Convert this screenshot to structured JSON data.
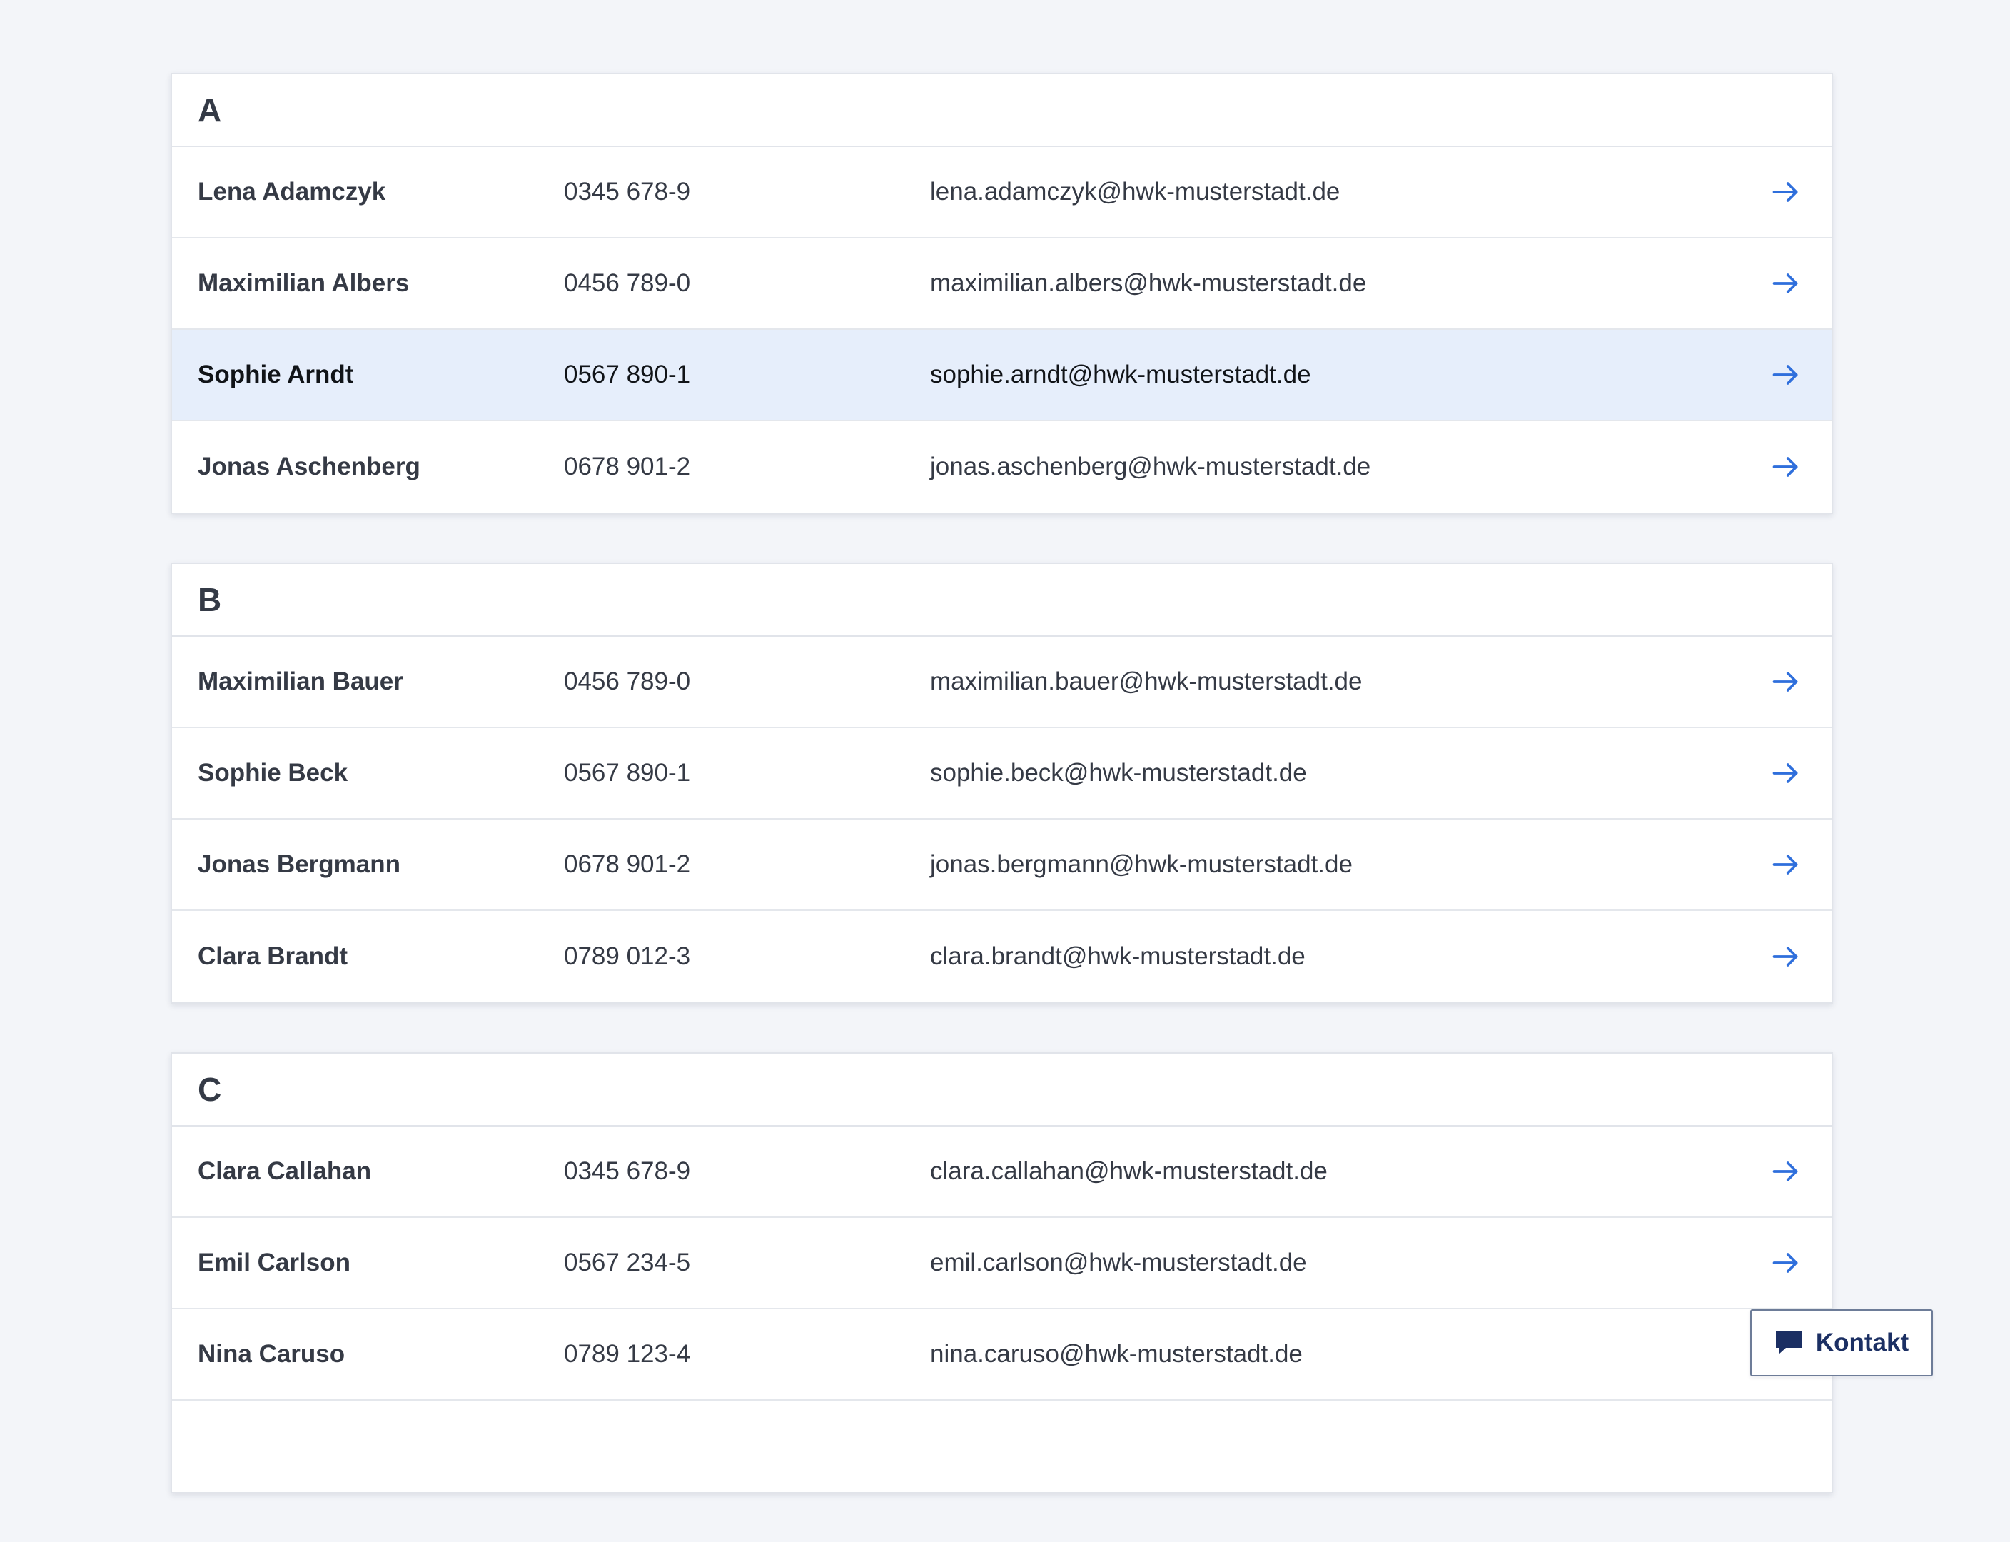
{
  "colors": {
    "page_background": "#f3f5f9",
    "selected_row": "#e6eefb",
    "arrow_accent": "#2f6fdc",
    "kontakt_text": "#1b2f63"
  },
  "groups": [
    {
      "letter": "A",
      "rows": [
        {
          "name": "Lena Adamczyk",
          "phone": "0345 678-9",
          "email": "lena.adamczyk@hwk-musterstadt.de",
          "selected": false
        },
        {
          "name": "Maximilian Albers",
          "phone": "0456 789-0",
          "email": "maximilian.albers@hwk-musterstadt.de",
          "selected": false
        },
        {
          "name": "Sophie Arndt",
          "phone": "0567 890-1",
          "email": "sophie.arndt@hwk-musterstadt.de",
          "selected": true
        },
        {
          "name": "Jonas Aschenberg",
          "phone": "0678 901-2",
          "email": "jonas.aschenberg@hwk-musterstadt.de",
          "selected": false
        }
      ]
    },
    {
      "letter": "B",
      "rows": [
        {
          "name": "Maximilian Bauer",
          "phone": "0456 789-0",
          "email": "maximilian.bauer@hwk-musterstadt.de",
          "selected": false
        },
        {
          "name": "Sophie Beck",
          "phone": "0567 890-1",
          "email": "sophie.beck@hwk-musterstadt.de",
          "selected": false
        },
        {
          "name": "Jonas Bergmann",
          "phone": "0678 901-2",
          "email": "jonas.bergmann@hwk-musterstadt.de",
          "selected": false
        },
        {
          "name": "Clara Brandt",
          "phone": "0789 012-3",
          "email": "clara.brandt@hwk-musterstadt.de",
          "selected": false
        }
      ]
    },
    {
      "letter": "C",
      "rows": [
        {
          "name": "Clara Callahan",
          "phone": "0345 678-9",
          "email": "clara.callahan@hwk-musterstadt.de",
          "selected": false
        },
        {
          "name": "Emil Carlson",
          "phone": "0567 234-5",
          "email": "emil.carlson@hwk-musterstadt.de",
          "selected": false
        },
        {
          "name": "Nina Caruso",
          "phone": "0789 123-4",
          "email": "nina.caruso@hwk-musterstadt.de",
          "selected": false
        },
        {
          "name": "",
          "phone": "",
          "email": "",
          "selected": false
        }
      ]
    }
  ],
  "icons": {
    "row_action": "arrow-right-icon",
    "kontakt": "chat-bubble-icon"
  },
  "kontakt_button": {
    "label": "Kontakt"
  }
}
